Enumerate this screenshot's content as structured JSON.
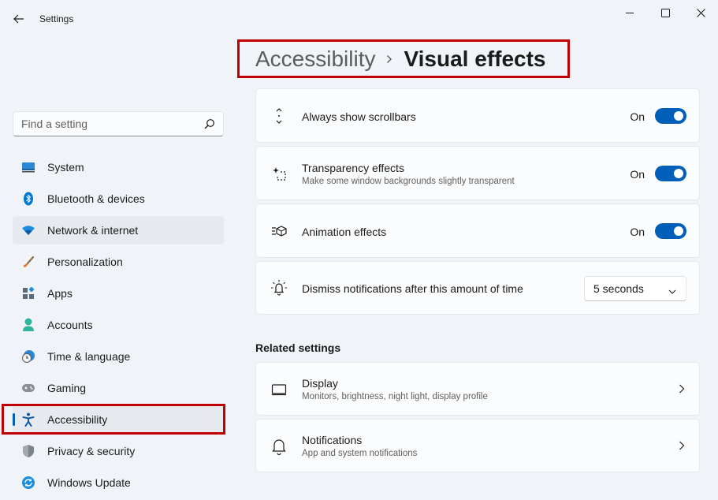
{
  "app": {
    "title": "Settings"
  },
  "search": {
    "placeholder": "Find a setting"
  },
  "sidebar": {
    "items": [
      {
        "label": "System",
        "icon": "system-icon"
      },
      {
        "label": "Bluetooth & devices",
        "icon": "bluetooth-icon"
      },
      {
        "label": "Network & internet",
        "icon": "wifi-icon"
      },
      {
        "label": "Personalization",
        "icon": "brush-icon"
      },
      {
        "label": "Apps",
        "icon": "apps-icon"
      },
      {
        "label": "Accounts",
        "icon": "person-icon"
      },
      {
        "label": "Time & language",
        "icon": "clock-globe-icon"
      },
      {
        "label": "Gaming",
        "icon": "gamepad-icon"
      },
      {
        "label": "Accessibility",
        "icon": "accessibility-icon"
      },
      {
        "label": "Privacy & security",
        "icon": "shield-icon"
      },
      {
        "label": "Windows Update",
        "icon": "update-icon"
      }
    ],
    "active_index": 8
  },
  "header": {
    "parent": "Accessibility",
    "current": "Visual effects"
  },
  "settings": {
    "scrollbars": {
      "title": "Always show scrollbars",
      "state": "On",
      "on": true,
      "icon": "scrollbar-icon"
    },
    "transparency": {
      "title": "Transparency effects",
      "description": "Make some window backgrounds slightly transparent",
      "state": "On",
      "on": true,
      "icon": "transparency-icon"
    },
    "animation": {
      "title": "Animation effects",
      "description": "",
      "state": "On",
      "on": true,
      "icon": "animation-icon"
    },
    "notifications_timeout": {
      "title": "Dismiss notifications after this amount of time",
      "value": "5 seconds",
      "icon": "bell-sparkle-icon"
    }
  },
  "related": {
    "title": "Related settings",
    "display": {
      "title": "Display",
      "description": "Monitors, brightness, night light, display profile",
      "icon": "monitor-icon"
    },
    "notifications": {
      "title": "Notifications",
      "description": "App and system notifications",
      "icon": "bell-icon"
    }
  },
  "colors": {
    "accent": "#005fb8",
    "highlight": "#c00000",
    "background": "#f0f4f9"
  }
}
